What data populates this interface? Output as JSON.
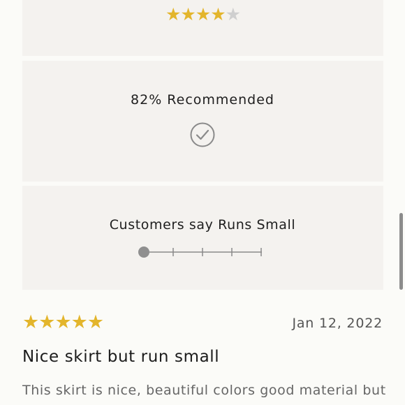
{
  "rating_panel": {
    "average_stars": 4,
    "max_stars": 5
  },
  "recommend_panel": {
    "text": "82% Recommended",
    "icon": "checkmark-circle-icon"
  },
  "fit_panel": {
    "text": "Customers say Runs Small",
    "scale_steps": 5,
    "selected_step": 1
  },
  "review": {
    "stars": 5,
    "date": "Jan 12, 2022",
    "title": "Nice skirt but run small",
    "body": "This skirt is nice, beautiful colors good material but"
  },
  "colors": {
    "star_on": "#e3b52c",
    "star_off": "#cfcfcf",
    "panel_bg": "#f4f2ef"
  }
}
